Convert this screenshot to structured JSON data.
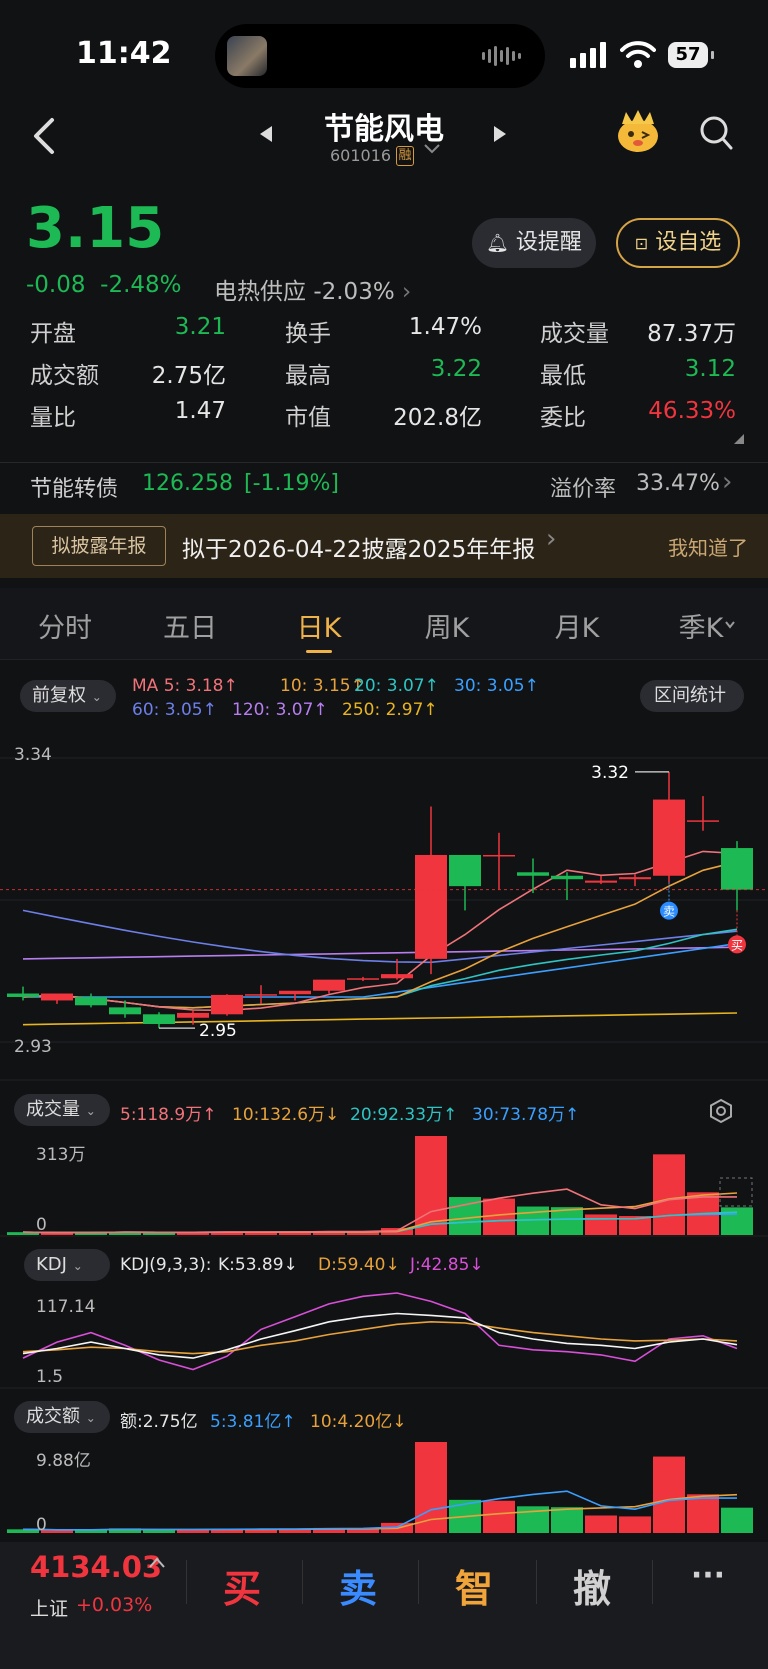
{
  "status": {
    "time": "11:42",
    "battery": "57"
  },
  "header": {
    "title": "节能风电",
    "code": "601016",
    "margin_badge": "融"
  },
  "quote": {
    "price": "3.15",
    "change": "-0.08",
    "change_pct": "-2.48%",
    "sector_name": "电热供应",
    "sector_pct": "-2.03%",
    "alert_label": "设提醒",
    "watch_label": "设自选",
    "rows": [
      [
        {
          "label": "开盘",
          "value": "3.21",
          "color": "#1db954"
        },
        {
          "label": "换手",
          "value": "1.47%",
          "color": "#e6e6e6"
        },
        {
          "label": "成交量",
          "value": "87.37万",
          "color": "#e6e6e6"
        }
      ],
      [
        {
          "label": "成交额",
          "value": "2.75亿",
          "color": "#e6e6e6"
        },
        {
          "label": "最高",
          "value": "3.22",
          "color": "#1db954"
        },
        {
          "label": "最低",
          "value": "3.12",
          "color": "#1db954"
        }
      ],
      [
        {
          "label": "量比",
          "value": "1.47",
          "color": "#e6e6e6"
        },
        {
          "label": "市值",
          "value": "202.8亿",
          "color": "#e6e6e6"
        },
        {
          "label": "委比",
          "value": "46.33%",
          "color": "#f0353f"
        }
      ]
    ]
  },
  "bond": {
    "name": "节能转债",
    "price": "126.258",
    "pct": "[-1.19%]",
    "premium_label": "溢价率",
    "premium_value": "33.47%"
  },
  "notice": {
    "tag": "拟披露年报",
    "text": "拟于2026-04-22披露2025年年报",
    "dismiss": "我知道了"
  },
  "tabs": [
    "分时",
    "五日",
    "日K",
    "周K",
    "月K",
    "季K"
  ],
  "active_tab": 2,
  "kline": {
    "adjust_label": "前复权",
    "stats_label": "区间统计",
    "ma_legend": [
      {
        "text": "MA 5: 3.18↑",
        "color": "#f0737a"
      },
      {
        "text": "10: 3.15↑",
        "color": "#e8a23c"
      },
      {
        "text": "20: 3.07↑",
        "color": "#2ec4c4"
      },
      {
        "text": "30: 3.05↑",
        "color": "#3aa0ff"
      },
      {
        "text": "60: 3.05↑",
        "color": "#6d7fe8"
      },
      {
        "text": "120: 3.07↑",
        "color": "#b77ef0"
      },
      {
        "text": "250: 2.97↑",
        "color": "#e8b420"
      }
    ],
    "y_high": "3.34",
    "y_low": "2.93",
    "max_label": "3.32",
    "min_label": "2.95",
    "sell_badge": "卖",
    "buy_badge": "买"
  },
  "volume": {
    "label": "成交量",
    "top": "313万",
    "zero": "0",
    "legend": [
      {
        "text": "5:118.9万↑",
        "color": "#f0737a"
      },
      {
        "text": "10:132.6万↓",
        "color": "#e8a23c"
      },
      {
        "text": "20:92.33万↑",
        "color": "#2ec4c4"
      },
      {
        "text": "30:73.78万↑",
        "color": "#3aa0ff"
      }
    ]
  },
  "kdj": {
    "label": "KDJ",
    "top": "117.14",
    "bottom": "1.5",
    "legend": [
      {
        "text": "KDJ(9,3,3):",
        "color": "#e6e6e6"
      },
      {
        "text": "K:53.89↓",
        "color": "#e6e6e6"
      },
      {
        "text": "D:59.40↓",
        "color": "#e8a23c"
      },
      {
        "text": "J:42.85↓",
        "color": "#d84fd8"
      }
    ]
  },
  "amount": {
    "label": "成交额",
    "top": "9.88亿",
    "zero": "0",
    "legend": [
      {
        "text": "额:2.75亿",
        "color": "#e6e6e6"
      },
      {
        "text": "5:3.81亿↑",
        "color": "#3aa0ff"
      },
      {
        "text": "10:4.20亿↓",
        "color": "#e8a23c"
      }
    ]
  },
  "index_bar": {
    "value": "4134.03",
    "name": "上证",
    "pct": "+0.03%",
    "buy": "买",
    "sell": "卖",
    "smart": "智",
    "cancel": "撤",
    "more": "···"
  },
  "chart_data": {
    "type": "candlestick",
    "candles": [
      {
        "o": 3.0,
        "h": 3.01,
        "l": 2.99,
        "c": 2.995
      },
      {
        "o": 2.99,
        "h": 3.0,
        "l": 2.985,
        "c": 3.0
      },
      {
        "o": 2.995,
        "h": 3.0,
        "l": 2.98,
        "c": 2.983
      },
      {
        "o": 2.98,
        "h": 2.99,
        "l": 2.965,
        "c": 2.97
      },
      {
        "o": 2.97,
        "h": 2.973,
        "l": 2.95,
        "c": 2.956
      },
      {
        "o": 2.965,
        "h": 2.975,
        "l": 2.955,
        "c": 2.972
      },
      {
        "o": 2.97,
        "h": 2.999,
        "l": 2.968,
        "c": 2.998
      },
      {
        "o": 2.998,
        "h": 3.012,
        "l": 2.985,
        "c": 2.999
      },
      {
        "o": 2.999,
        "h": 3.0,
        "l": 2.99,
        "c": 3.004
      },
      {
        "o": 3.004,
        "h": 3.012,
        "l": 3.0,
        "c": 3.02
      },
      {
        "o": 3.02,
        "h": 3.024,
        "l": 3.018,
        "c": 3.022
      },
      {
        "o": 3.022,
        "h": 3.05,
        "l": 3.02,
        "c": 3.028
      },
      {
        "o": 3.05,
        "h": 3.27,
        "l": 3.028,
        "c": 3.2
      },
      {
        "o": 3.2,
        "h": 3.2,
        "l": 3.12,
        "c": 3.155
      },
      {
        "o": 3.2,
        "h": 3.232,
        "l": 3.15,
        "c": 3.2
      },
      {
        "o": 3.175,
        "h": 3.195,
        "l": 3.145,
        "c": 3.17
      },
      {
        "o": 3.17,
        "h": 3.175,
        "l": 3.135,
        "c": 3.165
      },
      {
        "o": 3.16,
        "h": 3.17,
        "l": 3.158,
        "c": 3.163
      },
      {
        "o": 3.165,
        "h": 3.172,
        "l": 3.155,
        "c": 3.168
      },
      {
        "o": 3.17,
        "h": 3.32,
        "l": 3.16,
        "c": 3.28
      },
      {
        "o": 3.25,
        "h": 3.285,
        "l": 3.235,
        "c": 3.25
      },
      {
        "o": 3.21,
        "h": 3.22,
        "l": 3.12,
        "c": 3.15
      }
    ],
    "volume_wan": [
      9,
      7,
      8,
      11,
      7,
      10,
      10,
      10,
      11,
      12,
      12,
      22,
      313,
      120,
      115,
      90,
      88,
      65,
      60,
      255,
      135,
      87.37
    ],
    "amount_yi": [
      0.4,
      0.3,
      0.35,
      0.5,
      0.3,
      0.4,
      0.45,
      0.45,
      0.5,
      0.55,
      0.55,
      1.1,
      9.88,
      3.6,
      3.5,
      2.9,
      2.8,
      1.9,
      1.8,
      8.3,
      4.2,
      2.75
    ],
    "kdj": {
      "k": [
        22,
        30,
        40,
        30,
        20,
        15,
        28,
        45,
        58,
        72,
        80,
        85,
        82,
        78,
        55,
        45,
        38,
        35,
        30,
        40,
        45,
        36
      ],
      "d": [
        25,
        28,
        32,
        30,
        25,
        22,
        25,
        35,
        42,
        52,
        60,
        68,
        72,
        70,
        62,
        55,
        50,
        45,
        42,
        43,
        45,
        42
      ],
      "j": [
        15,
        40,
        55,
        35,
        12,
        -3,
        18,
        60,
        80,
        100,
        112,
        117.14,
        104,
        85,
        35,
        28,
        25,
        20,
        10,
        45,
        50,
        30
      ]
    }
  }
}
